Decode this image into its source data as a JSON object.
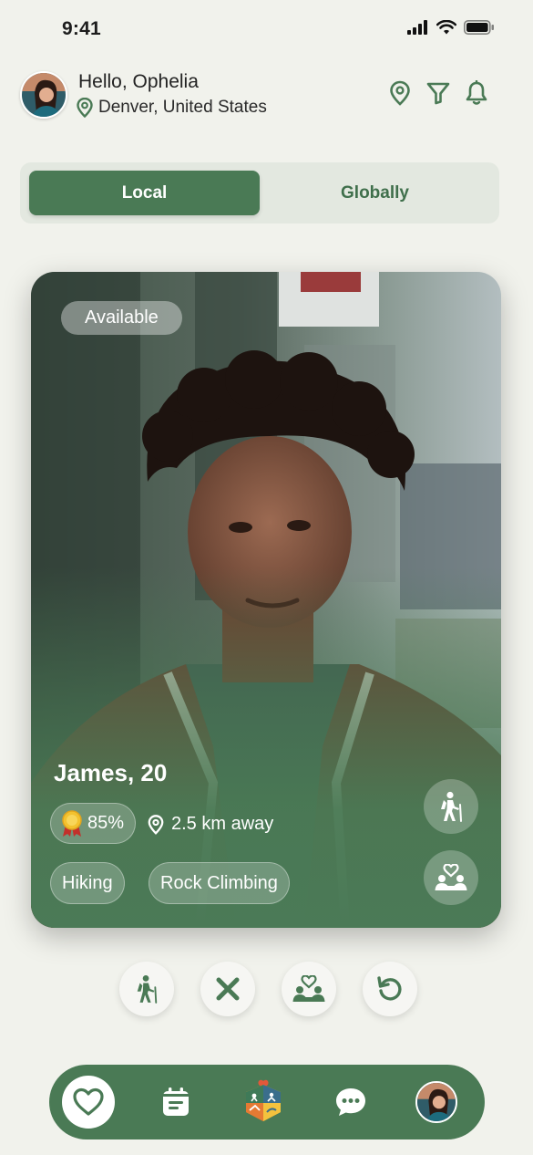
{
  "status_bar": {
    "time": "9:41"
  },
  "header": {
    "greeting": "Hello, Ophelia",
    "location": "Denver, United States",
    "actions": [
      "location-pin-icon",
      "filter-icon",
      "bell-icon"
    ]
  },
  "tabs": {
    "local": "Local",
    "globally": "Globally",
    "selected": "Local"
  },
  "card": {
    "badge": "Available",
    "name_age": "James, 20",
    "match_percent": "85%",
    "distance": "2.5 km away",
    "interests": [
      "Hiking",
      "Rock Climbing"
    ],
    "side_icons": [
      "hiking-icon",
      "friends-heart-icon"
    ]
  },
  "actions": [
    "hiking-icon",
    "close-icon",
    "friends-heart-icon",
    "undo-icon"
  ],
  "bottom_nav": {
    "items": [
      "heart-icon",
      "calendar-icon",
      "activity-badge-icon",
      "chat-icon",
      "profile-avatar"
    ],
    "active": "heart-icon"
  },
  "colors": {
    "primary": "#4a7a55",
    "background": "#f1f2ec",
    "segment_bg": "#e3e8e0"
  }
}
